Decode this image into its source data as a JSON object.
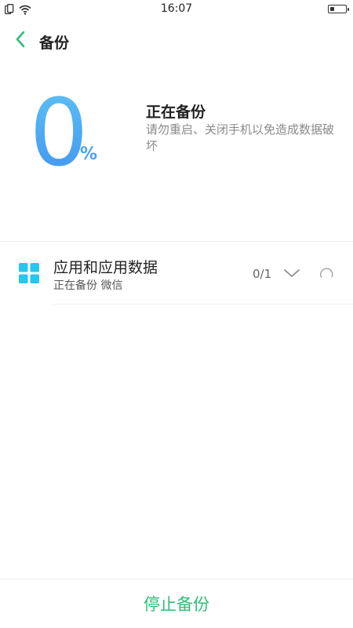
{
  "statusbar": {
    "time": "16:07",
    "icons": [
      "sim-cards-icon",
      "wifi-icon",
      "battery-icon"
    ],
    "battery_level": 0.3
  },
  "header": {
    "title": "备份",
    "back_icon": "chevron-left-icon"
  },
  "progress": {
    "percent_value": "0",
    "percent_sign": "%",
    "status_title": "正在备份",
    "status_desc": "请勿重启、关闭手机以免造成数据破坏"
  },
  "items": [
    {
      "title": "应用和应用数据",
      "subtitle": "正在备份 微信",
      "count": "0/1",
      "icon": "apps-grid-icon"
    }
  ],
  "bottom": {
    "stop_label": "停止备份"
  },
  "colors": {
    "accent": "#2fbe77",
    "progress_blue": "#4aa0ef",
    "icon_cyan": "#25c6f1"
  }
}
